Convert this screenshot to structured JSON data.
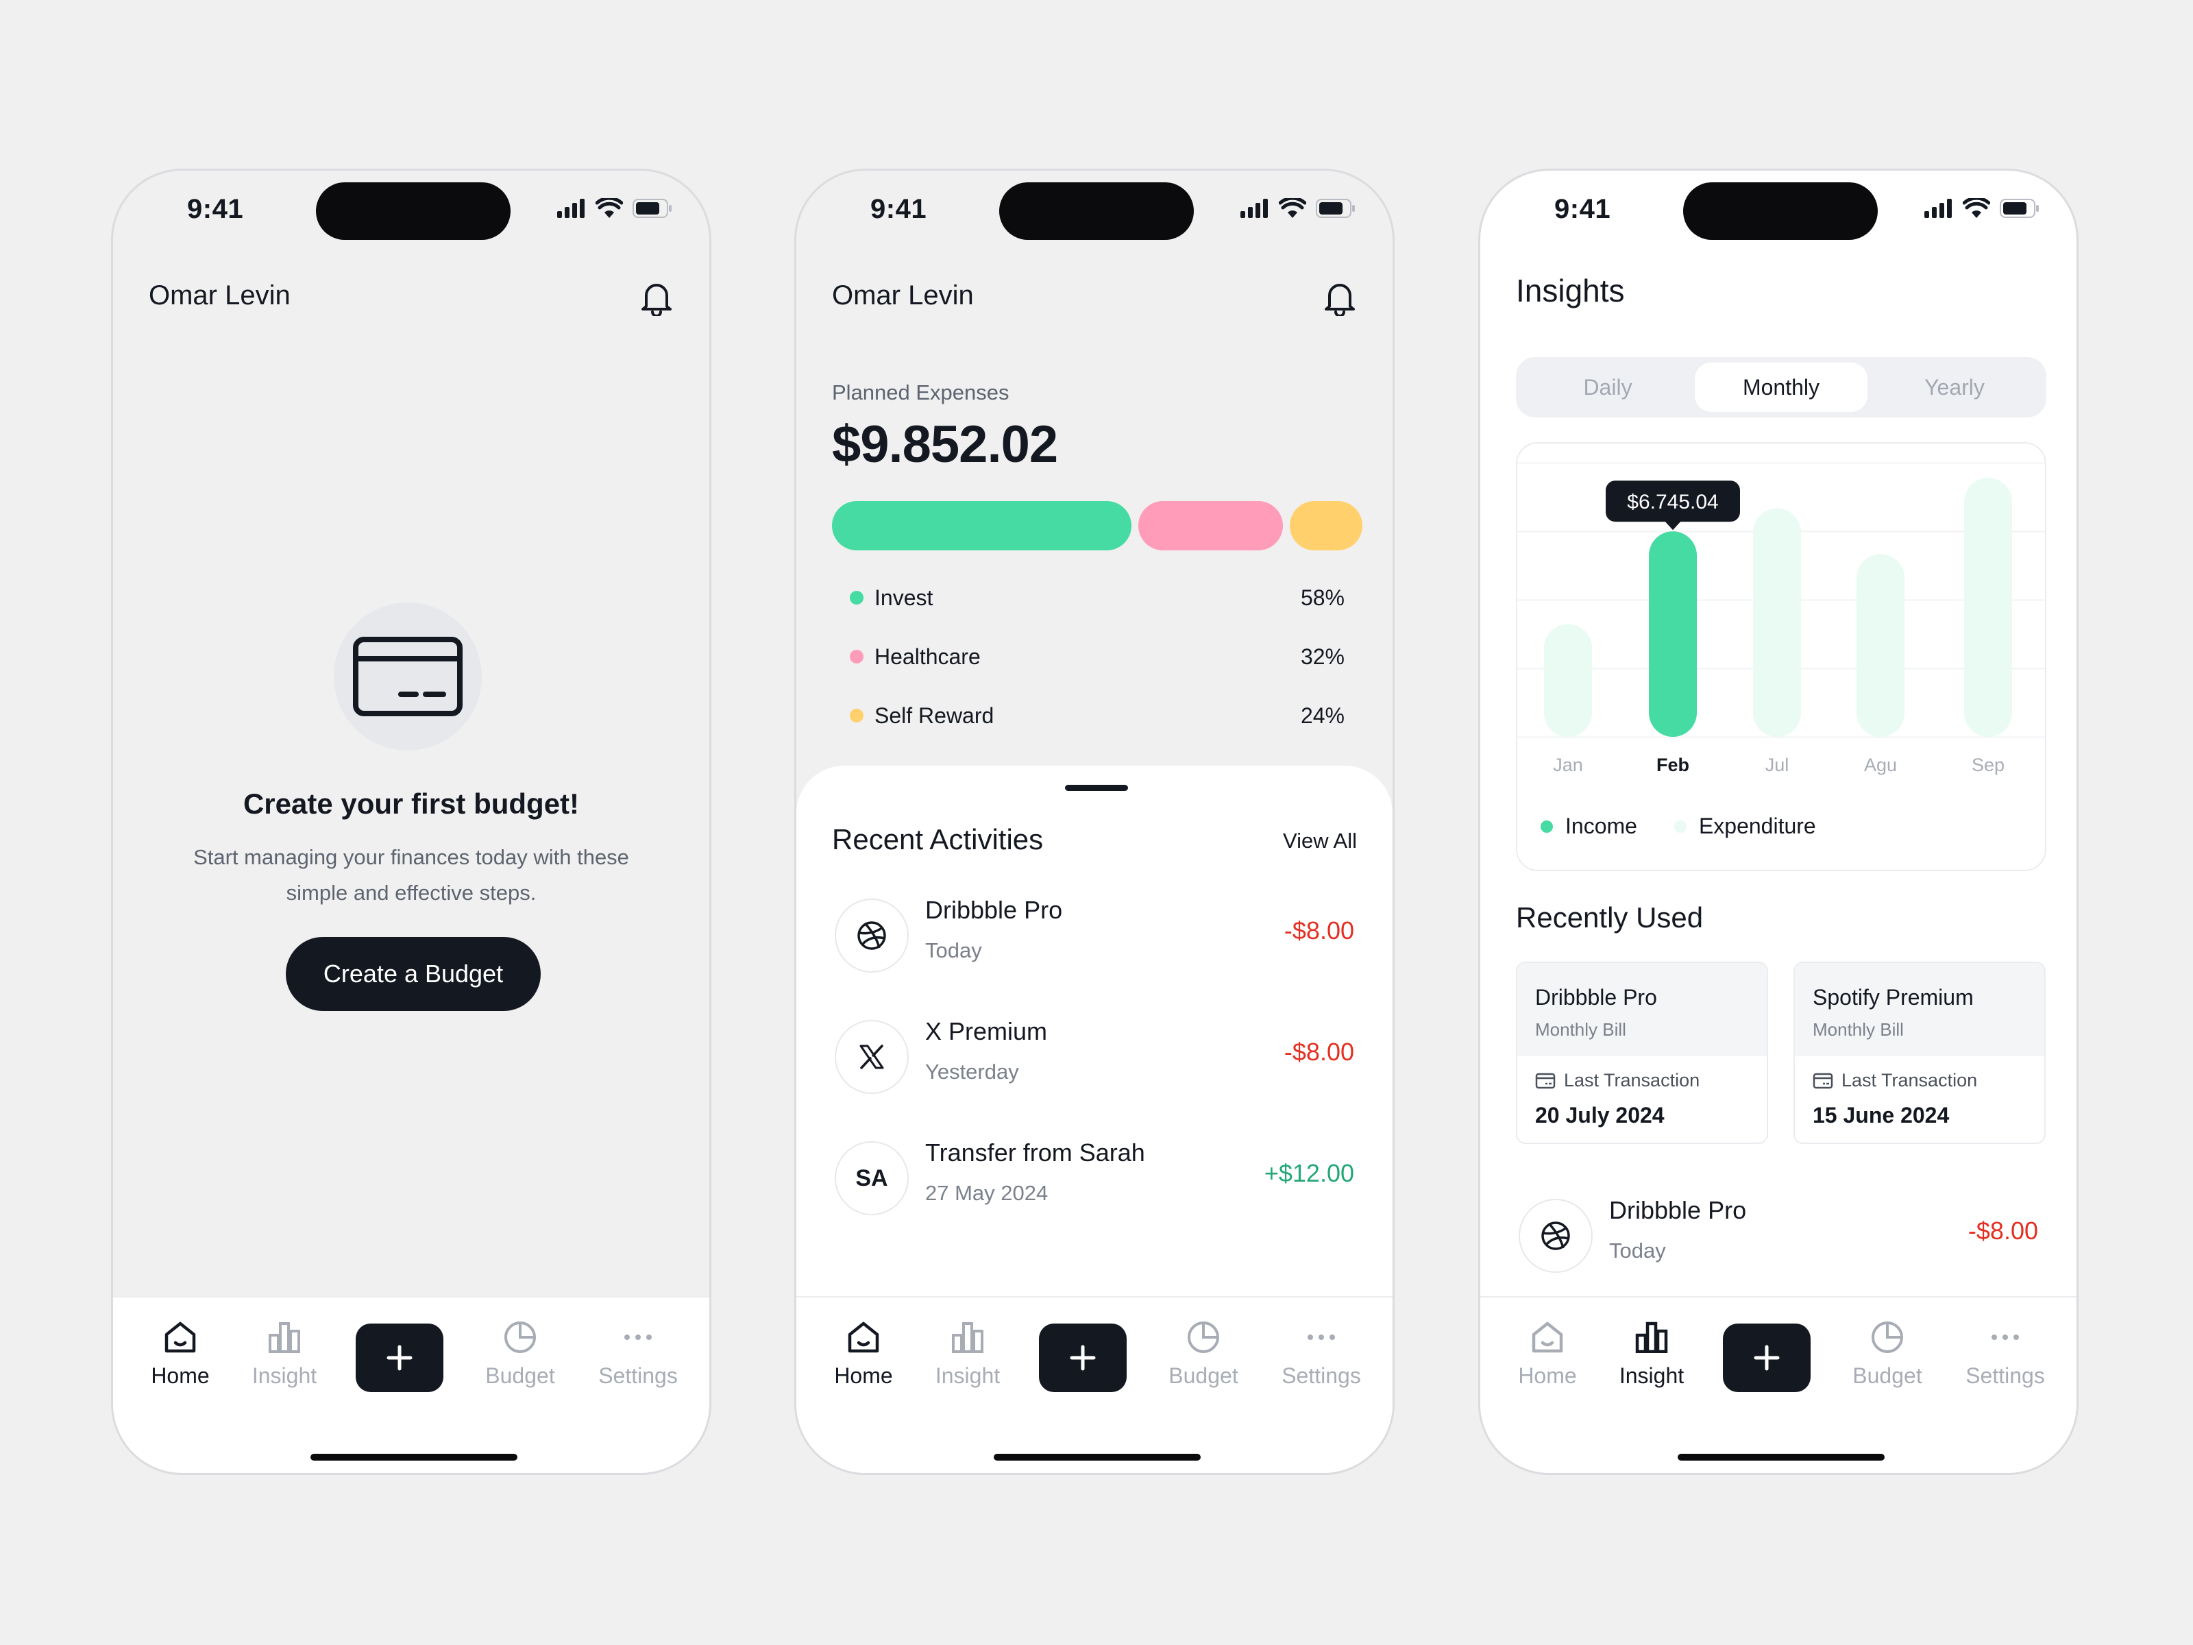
{
  "status": {
    "time": "9:41"
  },
  "nav": {
    "home": "Home",
    "insight": "Insight",
    "budget": "Budget",
    "settings": "Settings"
  },
  "screen1": {
    "user_name": "Omar Levin",
    "empty_title": "Create your first budget!",
    "empty_desc": "Start managing your finances today with these simple and effective steps.",
    "create_button": "Create a Budget"
  },
  "screen2": {
    "user_name": "Omar Levin",
    "planned_label": "Planned Expenses",
    "planned_amount": "$9.852.02",
    "allocations": [
      {
        "name": "Invest",
        "percent": "58%",
        "color": "#45dba2",
        "share": 58
      },
      {
        "name": "Healthcare",
        "percent": "32%",
        "color": "#ff9cb9",
        "share": 28
      },
      {
        "name": "Self Reward",
        "percent": "24%",
        "color": "#ffd06c",
        "share": 14
      }
    ],
    "recent_title": "Recent Activities",
    "view_all": "View All",
    "activities": [
      {
        "name": "Dribbble Pro",
        "date": "Today",
        "amount": "-$8.00",
        "icon": "dribbble-icon"
      },
      {
        "name": "X Premium",
        "date": "Yesterday",
        "amount": "-$8.00",
        "icon": "x-logo-icon"
      },
      {
        "name": "Transfer from Sarah",
        "date": "27 May 2024",
        "amount": "+$12.00",
        "initials": "SA"
      }
    ]
  },
  "screen3": {
    "title": "Insights",
    "tabs": [
      "Daily",
      "Monthly",
      "Yearly"
    ],
    "active_tab": "Monthly",
    "tooltip": "$6.745.04",
    "recently_used_title": "Recently Used",
    "bills": [
      {
        "name": "Dribbble Pro",
        "type": "Monthly Bill",
        "last_label": "Last Transaction",
        "last_date": "20 July 2024"
      },
      {
        "name": "Spotify Premium",
        "type": "Monthly Bill",
        "last_label": "Last Transaction",
        "last_date": "15 June 2024"
      }
    ],
    "activity": {
      "name": "Dribbble Pro",
      "date": "Today",
      "amount": "-$8.00"
    }
  },
  "chart_data": {
    "type": "bar",
    "categories": [
      "Jan",
      "Feb",
      "Jul",
      "Agu",
      "Sep"
    ],
    "series": [
      {
        "name": "Income",
        "values": [
          0,
          6745.04,
          0,
          0,
          0
        ]
      },
      {
        "name": "Expenditure",
        "values": [
          3700,
          0,
          7500,
          6000,
          8500
        ]
      }
    ],
    "highlighted_category": "Feb",
    "legend": [
      "Income",
      "Expenditure"
    ],
    "colors": {
      "income": "#45dba2",
      "expenditure": "#e9fbf3"
    },
    "ylim": [
      0,
      9000
    ],
    "grid": true
  }
}
